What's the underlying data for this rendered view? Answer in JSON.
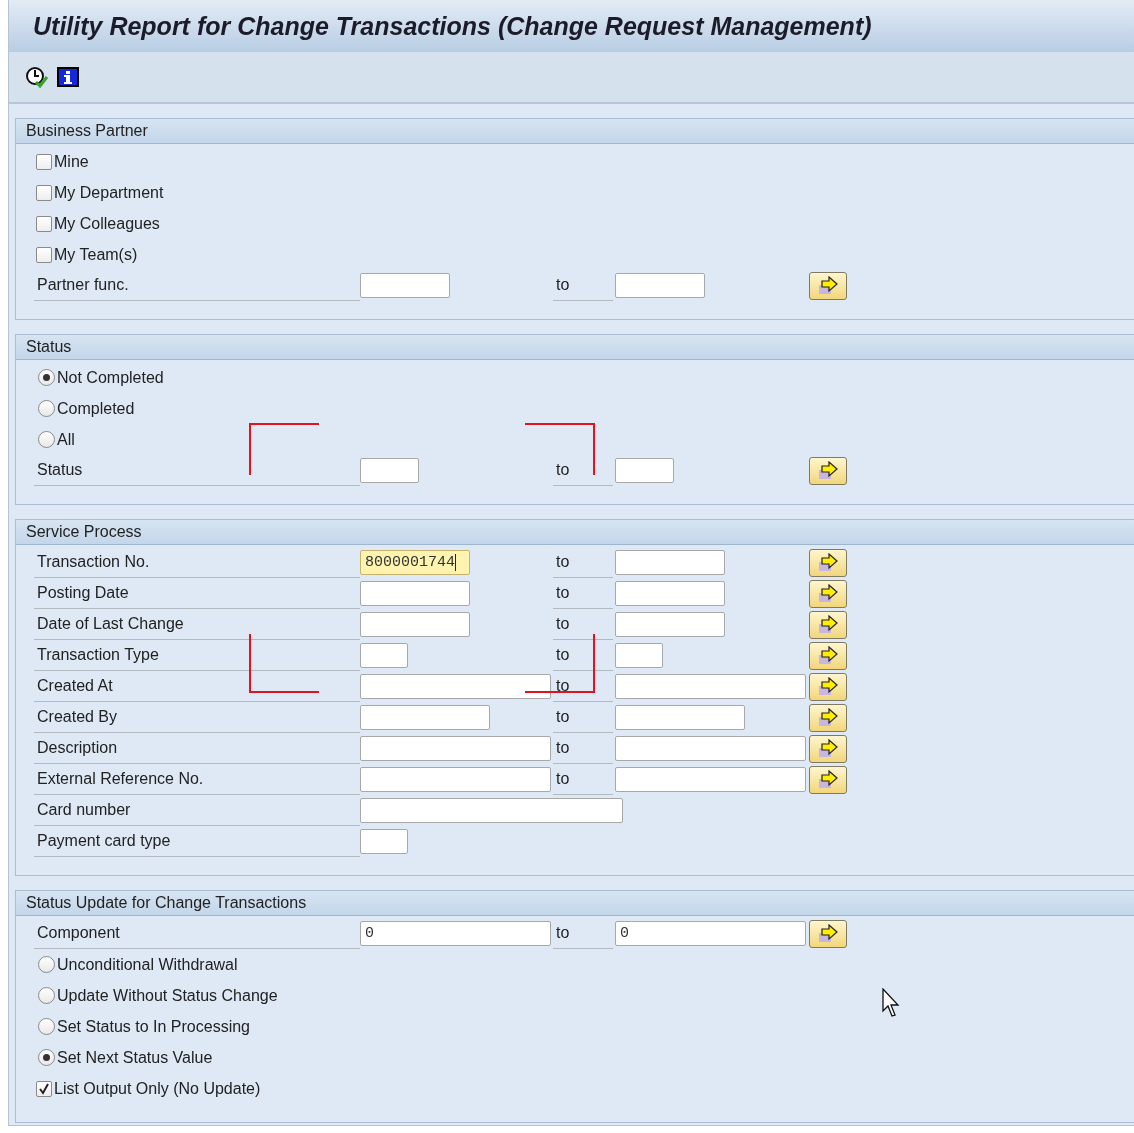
{
  "window": {
    "title": "Utility Report for Change Transactions (Change Request Management)"
  },
  "toolbar": {
    "buttons": [
      {
        "kind": "execute"
      },
      {
        "kind": "info"
      }
    ]
  },
  "sections": [
    {
      "title": "Business Partner",
      "rows": [
        {
          "kind": "checkbox",
          "label": "Mine",
          "checked": false
        },
        {
          "kind": "checkbox",
          "label": "My Department",
          "checked": false
        },
        {
          "kind": "checkbox",
          "label": "My Colleagues",
          "checked": false
        },
        {
          "kind": "checkbox",
          "label": "My Team(s)",
          "checked": false
        },
        {
          "kind": "range",
          "label": "Partner func.",
          "from": "",
          "to_label": "to",
          "to": "",
          "focused": false
        }
      ]
    },
    {
      "title": "Status",
      "rows": [
        {
          "kind": "radio",
          "label": "Not Completed",
          "selected": true
        },
        {
          "kind": "radio",
          "label": "Completed",
          "selected": false
        },
        {
          "kind": "radio",
          "label": "All",
          "selected": false
        },
        {
          "kind": "range",
          "label": "Status",
          "from": "",
          "to_label": "to",
          "to": "",
          "focused": false
        }
      ]
    },
    {
      "title": "Service Process",
      "rows": [
        {
          "kind": "range",
          "label": "Transaction No.",
          "from": "8000001744",
          "to_label": "to",
          "to": "",
          "focused": true
        },
        {
          "kind": "range",
          "label": "Posting Date",
          "from": "",
          "to_label": "to",
          "to": "",
          "focused": false
        },
        {
          "kind": "range",
          "label": "Date of Last Change",
          "from": "",
          "to_label": "to",
          "to": "",
          "focused": false
        },
        {
          "kind": "range",
          "label": "Transaction Type",
          "from": "",
          "to_label": "to",
          "to": "",
          "focused": false
        },
        {
          "kind": "range",
          "label": "Created At",
          "from": "",
          "to_label": "to",
          "to": "",
          "focused": false
        },
        {
          "kind": "range",
          "label": "Created By",
          "from": "",
          "to_label": "to",
          "to": "",
          "focused": false
        },
        {
          "kind": "range",
          "label": "Description",
          "from": "",
          "to_label": "to",
          "to": "",
          "focused": false
        },
        {
          "kind": "range",
          "label": "External Reference No.",
          "from": "",
          "to_label": "to",
          "to": "",
          "focused": false
        },
        {
          "kind": "single",
          "label": "Card number",
          "from": "",
          "focused": false
        },
        {
          "kind": "single",
          "label": "Payment card type",
          "from": "",
          "focused": false
        }
      ]
    },
    {
      "title": "Status Update for Change Transactions",
      "rows": [
        {
          "kind": "range",
          "label": "Component",
          "from": "0",
          "to_label": "to",
          "to": "0",
          "focused": false
        },
        {
          "kind": "radio",
          "label": "Unconditional Withdrawal",
          "selected": false
        },
        {
          "kind": "radio",
          "label": "Update Without Status Change",
          "selected": false
        },
        {
          "kind": "radio",
          "label": "Set Status to In Processing",
          "selected": false
        },
        {
          "kind": "radio",
          "label": "Set Next Status Value",
          "selected": true
        },
        {
          "kind": "checkbox",
          "label": "List Output Only (No Update)",
          "checked": true
        }
      ]
    }
  ]
}
